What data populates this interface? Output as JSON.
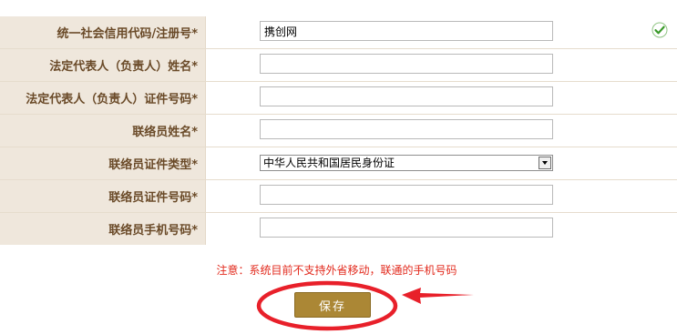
{
  "form": {
    "rows": [
      {
        "label": "统一社会信用代码/注册号*",
        "type": "text",
        "value": "携创网",
        "valid": true
      },
      {
        "label": "法定代表人（负责人）姓名*",
        "type": "text",
        "value": ""
      },
      {
        "label": "法定代表人（负责人）证件号码*",
        "type": "text",
        "value": ""
      },
      {
        "label": "联络员姓名*",
        "type": "text",
        "value": ""
      },
      {
        "label": "联络员证件类型*",
        "type": "select",
        "value": "中华人民共和国居民身份证"
      },
      {
        "label": "联络员证件号码*",
        "type": "text",
        "value": ""
      },
      {
        "label": "联络员手机号码*",
        "type": "text",
        "value": ""
      }
    ]
  },
  "notice": "注意：系统目前不支持外省移动，联通的手机号码",
  "save_button": {
    "label": "保存"
  },
  "colors": {
    "label_bg": "#efe7dc",
    "label_text": "#6a4a28",
    "notice": "#e22a1d",
    "button": "#ab8735",
    "annotation": "#e8202a",
    "valid_icon": "#3a9a2a"
  },
  "icons": {
    "valid": "check-icon"
  },
  "annotations": {
    "highlight": "red-circle-and-arrow-pointing-at-save-button"
  }
}
